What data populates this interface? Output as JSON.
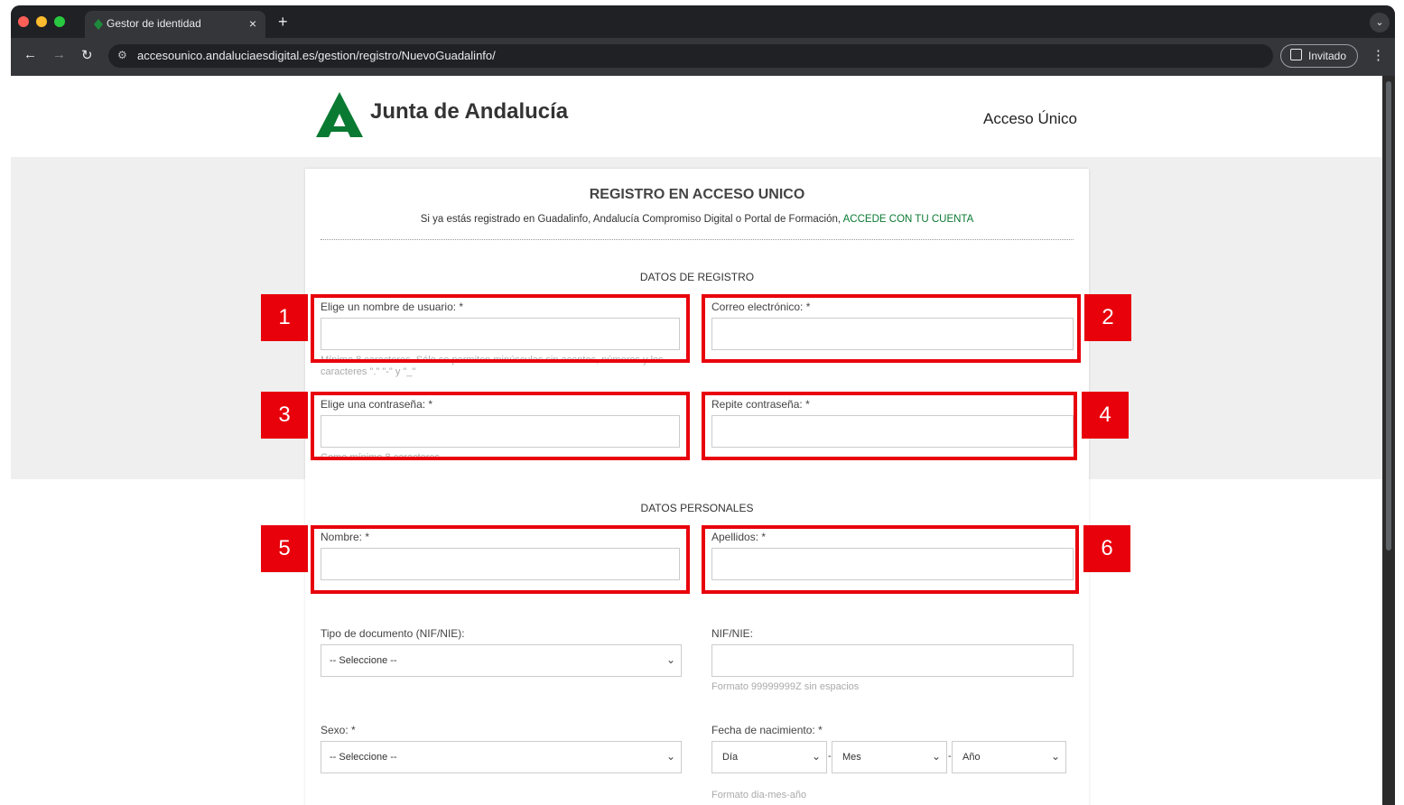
{
  "browser": {
    "tab_title": "Gestor de identidad",
    "tab_close": "×",
    "new_tab": "+",
    "tab_menu": "⌄",
    "url": "accesounico.andaluciaesdigital.es/gestion/registro/NuevoGuadalinfo/",
    "profile_label": "Invitado",
    "icons": [
      "back-icon",
      "forward-icon",
      "reload-icon",
      "site-info-icon",
      "profile-icon",
      "kebab-menu-icon"
    ],
    "colors": {
      "close": "#ff5f57",
      "minimize": "#febc2e",
      "maximize": "#28c840"
    }
  },
  "site": {
    "logo_text": "Junta de Andalucía",
    "nav_link": "Acceso Único",
    "brand_color": "#0a7a32"
  },
  "form": {
    "title": "REGISTRO EN ACCESO UNICO",
    "subtitle": "Si ya estás registrado en Guadalinfo, Andalucía Compromiso Digital o Portal de Formación,",
    "login_link": "ACCEDE CON TU CUENTA",
    "section_registro": "DATOS DE REGISTRO",
    "username_label": "Elige un nombre de usuario: *",
    "username_help": "Mínimo 8 caracteres. Sólo se permiten minúsculas sin acentos, números y los caracteres \".\" \"-\" y \"_\"",
    "email_label": "Correo electrónico: *",
    "password_label": "Elige una contraseña: *",
    "password_help": "Como mínimo 8 caracteres",
    "repeat_password_label": "Repite contraseña: *",
    "section_personales": "DATOS PERSONALES",
    "nombre_label": "Nombre: *",
    "apellidos_label": "Apellidos: *",
    "doc_type_label": "Tipo de documento (NIF/NIE):",
    "doc_type_value": "-- Seleccione --",
    "nif_label": "NIF/NIE:",
    "nif_help": "Formato 99999999Z sin espacios",
    "sexo_label": "Sexo: *",
    "sexo_value": "-- Seleccione --",
    "birth_label": "Fecha de nacimiento: *",
    "birth_day": "Día",
    "birth_month": "Mes",
    "birth_year": "Año",
    "birth_separator": "-",
    "birth_help": "Formato dia-mes-año"
  },
  "annotations": {
    "badges": [
      "1",
      "2",
      "3",
      "4",
      "5",
      "6"
    ],
    "color": "#e8000b"
  }
}
